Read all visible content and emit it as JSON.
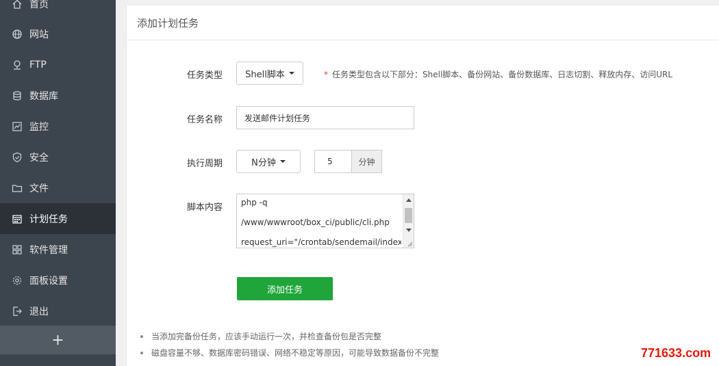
{
  "sidebar": {
    "items": [
      {
        "label": "首页",
        "icon": "home-icon"
      },
      {
        "label": "网站",
        "icon": "globe-icon"
      },
      {
        "label": "FTP",
        "icon": "ftp-icon"
      },
      {
        "label": "数据库",
        "icon": "database-icon"
      },
      {
        "label": "监控",
        "icon": "monitor-icon"
      },
      {
        "label": "安全",
        "icon": "shield-icon"
      },
      {
        "label": "文件",
        "icon": "folder-icon"
      },
      {
        "label": "计划任务",
        "icon": "calendar-icon",
        "active": true
      },
      {
        "label": "软件管理",
        "icon": "grid-icon"
      },
      {
        "label": "面板设置",
        "icon": "gear-icon"
      },
      {
        "label": "退出",
        "icon": "logout-icon"
      }
    ],
    "add_label": "+"
  },
  "panel": {
    "title": "添加计划任务"
  },
  "form": {
    "type_label": "任务类型",
    "type_value": "Shell脚本",
    "type_hint_star": "*",
    "type_hint": "任务类型包含以下部分：Shell脚本、备份网站、备份数据库、日志切割、释放内存、访问URL",
    "name_label": "任务名称",
    "name_value": "发送邮件计划任务",
    "cycle_label": "执行周期",
    "cycle_value": "N分钟",
    "minutes_value": "5",
    "minutes_unit": "分钟",
    "script_label": "脚本内容",
    "script_lines": [
      "php -q",
      "/www/wwwroot/box_ci/public/cli.php",
      "request_uri=\"/crontab/sendemail/index\""
    ],
    "submit_label": "添加任务"
  },
  "tips": [
    "当添加完备份任务，应该手动运行一次，并检查备份包是否完整",
    "磁盘容量不够、数据库密码错误、网络不稳定等原因，可能导致数据备份不完整"
  ],
  "watermark": "771633.com",
  "colors": {
    "sidebar_bg": "#3c444d",
    "sidebar_active": "#2c3138",
    "accent_green": "#20a53a",
    "hint_star": "#e33333",
    "watermark": "#e8190a"
  }
}
